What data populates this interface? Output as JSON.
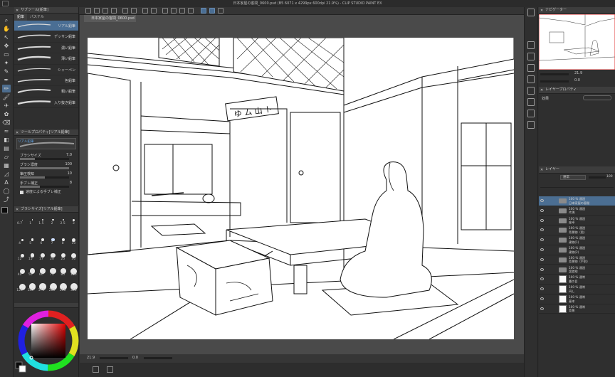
{
  "window": {
    "title": "日本家屋の客間_0600.psd (B5 6071 x 4299px 600dpi 21.9%) - CLIP STUDIO PAINT EX"
  },
  "sub_tool": {
    "panel_title": "サブツール[鉛筆]",
    "tabs": [
      "鉛筆",
      "パステル"
    ],
    "brushes": [
      "リアル鉛筆",
      "デッサン鉛筆",
      "濃い鉛筆",
      "薄い鉛筆",
      "シャーペン",
      "色鉛筆",
      "粗い鉛筆",
      "入り抜き鉛筆"
    ],
    "selected_index": 0
  },
  "tool_property": {
    "panel_title": "ツールプロパティ[リアル鉛筆]",
    "preview_label": "リアル鉛筆",
    "brush_size_label": "ブラシサイズ",
    "brush_size_value": "7.0",
    "brush_size_fill": 0.3,
    "density_label": "ブラシ濃度",
    "density_value": "100",
    "density_fill": 1.0,
    "stabilize_label": "筆圧検知",
    "stabilize_value": "10",
    "stabilize_fill": 0.5,
    "taper_label": "手ブレ補正",
    "taper_value": "8",
    "taper_fill": 0.4,
    "checkbox_label": "速度による手ブレ補正"
  },
  "brush_size_panel": {
    "panel_title": "ブラシサイズ[リアル鉛筆]",
    "row1": [
      "0.7",
      "1",
      "1.5",
      "2",
      "2.5",
      "3"
    ],
    "row2": [
      "4",
      "5",
      "6",
      "7",
      "8",
      "10"
    ],
    "row3": [
      "12",
      "15",
      "17",
      "20",
      "25",
      "30"
    ],
    "row4": [
      "40",
      "50",
      "60",
      "70",
      "80",
      "100"
    ],
    "row5": [
      "120",
      "150",
      "170",
      "200",
      "250",
      "300"
    ]
  },
  "navigator": {
    "panel_title": "ナビゲーター",
    "zoom_value": "21.9",
    "rotate_value": "0.0"
  },
  "layer_property": {
    "panel_title": "レイヤープロパティ",
    "effect_label": "効果"
  },
  "layer_panel": {
    "panel_title": "レイヤー",
    "blend_mode": "通常",
    "opacity": "100",
    "layers": [
      {
        "line1": "100 % 通過",
        "line2": "日本家屋の客間",
        "type": "folder",
        "selected": true
      },
      {
        "line1": "100 % 通過",
        "line2": "片隅",
        "type": "folder",
        "selected": false
      },
      {
        "line1": "100 % 通過",
        "line2": "座卓",
        "type": "folder",
        "selected": false
      },
      {
        "line1": "100 % 通過",
        "line2": "背景物（奥）",
        "type": "folder",
        "selected": false
      },
      {
        "line1": "100 % 通過",
        "line2": "建物(1)",
        "type": "folder",
        "selected": false
      },
      {
        "line1": "100 % 通過",
        "line2": "建物(2)",
        "type": "folder",
        "selected": false
      },
      {
        "line1": "100 % 通過",
        "line2": "背景物（手前）",
        "type": "folder",
        "selected": false
      },
      {
        "line1": "100 % 通過",
        "line2": "誤差線",
        "type": "folder",
        "selected": false
      },
      {
        "line1": "100 % 通常",
        "line2": "畳の目",
        "type": "raster",
        "selected": false
      },
      {
        "line1": "100 % 通常",
        "line2": "円し",
        "type": "raster",
        "selected": false
      },
      {
        "line1": "100 % 通常",
        "line2": "基本",
        "type": "raster",
        "selected": false
      },
      {
        "line1": "100 % 通常",
        "line2": "背景",
        "type": "raster",
        "selected": false
      }
    ]
  },
  "canvas": {
    "doc_tab": "日本家屋の客間_0600.psd",
    "zoom_value": "21.9",
    "rotate_value": "0.0"
  },
  "colors": {
    "selected": "#4a6e94",
    "fg_color": "#0b0b0b",
    "bg_color": "#ffffff"
  }
}
